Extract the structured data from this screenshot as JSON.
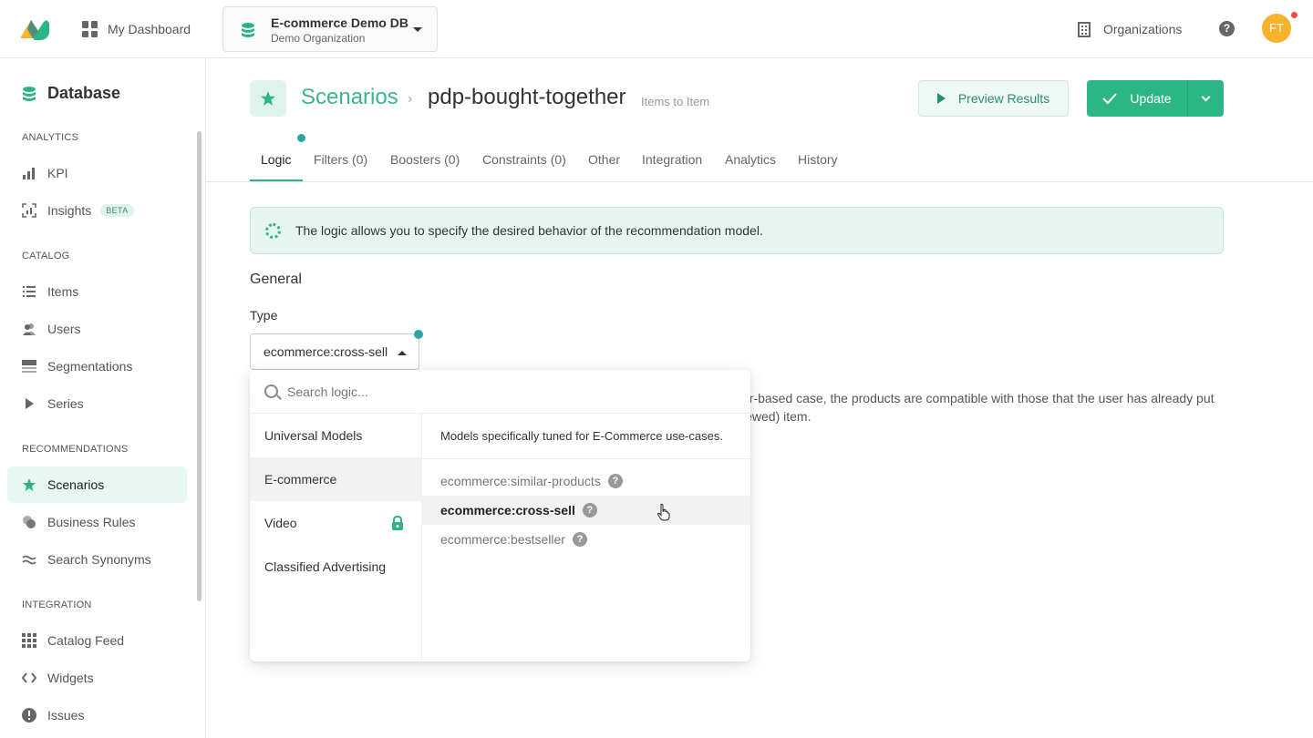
{
  "topbar": {
    "dashboard_label": "My Dashboard",
    "db_name": "E-commerce Demo DB",
    "db_org": "Demo Organization",
    "organizations_label": "Organizations",
    "help_glyph": "?",
    "avatar_initials": "FT"
  },
  "sidebar": {
    "title": "Database",
    "sections": {
      "analytics": "ANALYTICS",
      "catalog": "CATALOG",
      "recommendations": "RECOMMENDATIONS",
      "integration": "INTEGRATION"
    },
    "items": {
      "kpi": "KPI",
      "insights": "Insights",
      "insights_badge": "BETA",
      "items": "Items",
      "users": "Users",
      "segmentations": "Segmentations",
      "series": "Series",
      "scenarios": "Scenarios",
      "business_rules": "Business Rules",
      "search_synonyms": "Search Synonyms",
      "catalog_feed": "Catalog Feed",
      "widgets": "Widgets",
      "issues": "Issues"
    }
  },
  "header": {
    "breadcrumb_root": "Scenarios",
    "breadcrumb_sep": "›",
    "scenario_name": "pdp-bought-together",
    "scenario_type": "Items to Item",
    "preview_label": "Preview Results",
    "update_label": "Update"
  },
  "tabs": {
    "logic": "Logic",
    "filters": "Filters (0)",
    "boosters": "Boosters (0)",
    "constraints": "Constraints (0)",
    "other": "Other",
    "integration": "Integration",
    "analytics": "Analytics",
    "history": "History"
  },
  "logic": {
    "info_text": "The logic allows you to specify the desired behavior of the recommendation model.",
    "general_heading": "General",
    "type_label": "Type",
    "type_value": "ecommerce:cross-sell",
    "bg_desc_line1": "er-based case, the products are compatible with those that the user has already put",
    "bg_desc_line2": "iewed) item."
  },
  "dropdown": {
    "search_placeholder": "Search logic...",
    "categories": {
      "universal": "Universal Models",
      "ecommerce": "E-commerce",
      "video": "Video",
      "classified": "Classified Advertising"
    },
    "category_description": "Models specifically tuned for E-Commerce use-cases.",
    "options": {
      "similar": "ecommerce:similar-products",
      "cross_sell": "ecommerce:cross-sell",
      "bestseller": "ecommerce:bestseller"
    },
    "help_glyph": "?"
  },
  "colors": {
    "brand_green": "#2db685",
    "notification_red": "#ef4b4b",
    "avatar_yellow": "#f7b32b"
  }
}
